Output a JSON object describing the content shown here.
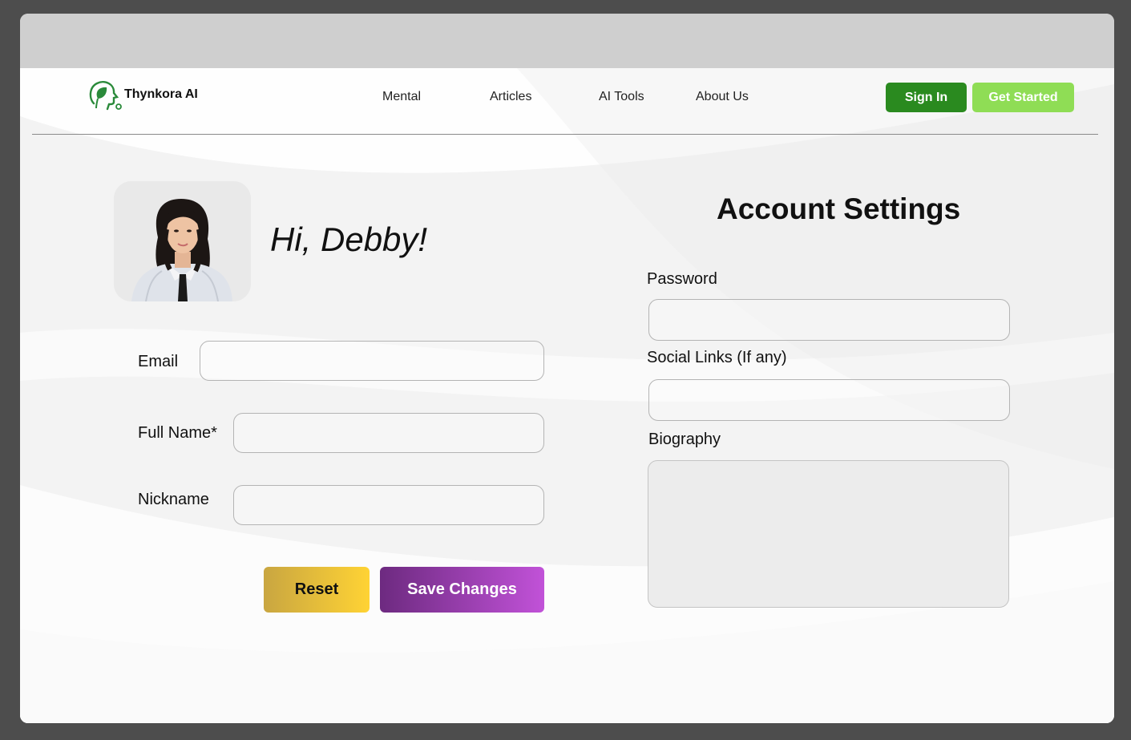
{
  "brand": {
    "name": "Thynkora AI",
    "logo_icon": "head-leaf-icon"
  },
  "nav": {
    "links": [
      "Mental",
      "Articles",
      "AI Tools",
      "About Us"
    ],
    "sign_in": "Sign In",
    "get_started": "Get Started"
  },
  "profile": {
    "greeting": "Hi, Debby!",
    "avatar_icon": "user-photo",
    "fields": {
      "email": {
        "label": "Email",
        "value": "",
        "placeholder": ""
      },
      "full_name": {
        "label": "Full Name*",
        "value": "",
        "placeholder": ""
      },
      "nickname": {
        "label": "Nickname",
        "value": "",
        "placeholder": ""
      }
    },
    "buttons": {
      "reset": "Reset",
      "save": "Save Changes"
    }
  },
  "account": {
    "title": "Account Settings",
    "password": {
      "label": "Password",
      "value": "",
      "placeholder": ""
    },
    "social_links": {
      "label": "Social Links (If any)",
      "value": "",
      "placeholder": ""
    },
    "biography": {
      "label": "Biography",
      "value": "",
      "placeholder": ""
    }
  },
  "colors": {
    "sign_in_bg": "#2a8a1f",
    "get_started_bg": "#8fdd55",
    "reset_gradient": [
      "#c9a641",
      "#ffd334"
    ],
    "save_gradient": [
      "#6d2a80",
      "#c152d8"
    ],
    "brand_green": "#2a8a3a"
  }
}
